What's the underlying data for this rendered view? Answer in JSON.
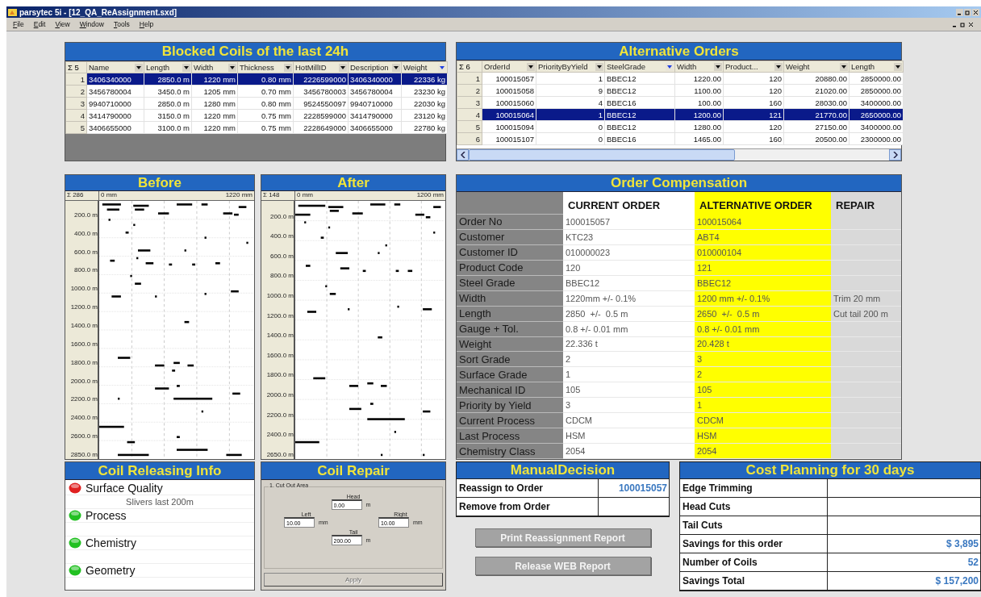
{
  "window": {
    "title": "parsytec 5i - [12_QA_ReAssignment.sxd]"
  },
  "menu": [
    "File",
    "Edit",
    "View",
    "Window",
    "Tools",
    "Help"
  ],
  "blocked_coils": {
    "title": "Blocked Coils of the last 24h",
    "count": "Σ 5",
    "columns": [
      {
        "label": "Name",
        "sorted": false
      },
      {
        "label": "Length",
        "sorted": false
      },
      {
        "label": "Width",
        "sorted": false
      },
      {
        "label": "Thickness",
        "sorted": false
      },
      {
        "label": "HotMillID",
        "sorted": false
      },
      {
        "label": "Description",
        "sorted": false
      },
      {
        "label": "Weight",
        "sorted": true
      }
    ],
    "rows": [
      {
        "index": "1",
        "selected": true,
        "cells": [
          "3406340000",
          "2850.0 m",
          "1220 mm",
          "0.80 mm",
          "2226599000",
          "3406340000",
          "22336 kg"
        ]
      },
      {
        "index": "2",
        "selected": false,
        "cells": [
          "3456780004",
          "3450.0 m",
          "1205 mm",
          "0.70 mm",
          "3456780003",
          "3456780004",
          "23230 kg"
        ]
      },
      {
        "index": "3",
        "selected": false,
        "cells": [
          "9940710000",
          "2850.0 m",
          "1280 mm",
          "0.80 mm",
          "9524550097",
          "9940710000",
          "22030 kg"
        ]
      },
      {
        "index": "4",
        "selected": false,
        "cells": [
          "3414790000",
          "3150.0 m",
          "1220 mm",
          "0.75 mm",
          "2228599000",
          "3414790000",
          "23120 kg"
        ]
      },
      {
        "index": "5",
        "selected": false,
        "cells": [
          "3406655000",
          "3100.0 m",
          "1220 mm",
          "0.75 mm",
          "2228649000",
          "3406655000",
          "22780 kg"
        ]
      }
    ]
  },
  "alternative_orders": {
    "title": "Alternative Orders",
    "count": "Σ 6",
    "columns": [
      {
        "label": "OrderId",
        "sorted": false
      },
      {
        "label": "PriorityByYield",
        "sorted": false
      },
      {
        "label": "SteelGrade",
        "sorted": true
      },
      {
        "label": "Width",
        "sorted": false
      },
      {
        "label": "Product...",
        "sorted": false
      },
      {
        "label": "Weight",
        "sorted": false
      },
      {
        "label": "Length",
        "sorted": false
      }
    ],
    "rows": [
      {
        "index": "1",
        "selected": false,
        "cells": [
          "100015057",
          "1",
          "BBEC12",
          "1220.00",
          "120",
          "20880.00",
          "2850000.00"
        ]
      },
      {
        "index": "2",
        "selected": false,
        "cells": [
          "100015058",
          "9",
          "BBEC12",
          "1100.00",
          "120",
          "21020.00",
          "2850000.00"
        ]
      },
      {
        "index": "3",
        "selected": false,
        "cells": [
          "100015060",
          "4",
          "BBEC16",
          "100.00",
          "160",
          "28030.00",
          "3400000.00"
        ]
      },
      {
        "index": "4",
        "selected": true,
        "cells": [
          "100015064",
          "1",
          "BBEC12",
          "1200.00",
          "121",
          "21770.00",
          "2650000.00"
        ]
      },
      {
        "index": "5",
        "selected": false,
        "cells": [
          "100015094",
          "0",
          "BBEC12",
          "1280.00",
          "120",
          "27150.00",
          "3400000.00"
        ]
      },
      {
        "index": "6",
        "selected": false,
        "cells": [
          "100015107",
          "0",
          "BBEC16",
          "1465.00",
          "160",
          "20500.00",
          "2300000.00"
        ]
      }
    ]
  },
  "before": {
    "title": "Before",
    "count": "Σ 286",
    "x_start": "0 mm",
    "x_end": "1220 mm",
    "y_ticks": [
      "200.0 m",
      "400.0 m",
      "600.0 m",
      "800.0 m",
      "1000.0 m",
      "1200.0 m",
      "1400.0 m",
      "1600.0 m",
      "1800.0 m",
      "2000.0 m",
      "2200.0 m",
      "2400.0 m",
      "2600.0 m",
      "2850.0 m"
    ]
  },
  "after": {
    "title": "After",
    "count": "Σ 148",
    "x_start": "0 mm",
    "x_end": "1200 mm",
    "y_ticks": [
      "200.0 m",
      "400.0 m",
      "600.0 m",
      "800.0 m",
      "1000.0 m",
      "1200.0 m",
      "1400.0 m",
      "1600.0 m",
      "1800.0 m",
      "2000.0 m",
      "2200.0 m",
      "2400.0 m",
      "2650.0 m"
    ]
  },
  "order_compensation": {
    "title": "Order Compensation",
    "columns": [
      "CURRENT ORDER",
      "ALTERNATIVE ORDER",
      "REPAIR"
    ],
    "rows": [
      {
        "label": "Order No",
        "current": "100015057",
        "alternative": "100015064"
      },
      {
        "label": "Customer",
        "current": "KTC23",
        "alternative": "ABT4"
      },
      {
        "label": "Customer ID",
        "current": "010000023",
        "alternative": "010000104"
      },
      {
        "label": "Product Code",
        "current": "120",
        "alternative": "121"
      },
      {
        "label": "Steel Grade",
        "current": "BBEC12",
        "alternative": "BBEC12"
      },
      {
        "label": "Width",
        "current": "1220mm +/- 0.1%",
        "alternative": "1200 mm +/- 0.1%",
        "repair": "Trim 20 mm"
      },
      {
        "label": "Length",
        "current": "2850  +/-  0.5 m",
        "alternative": "2650  +/-  0.5 m",
        "repair": "Cut tail 200 m"
      },
      {
        "label": "Gauge + Tol.",
        "current": "0.8 +/- 0.01 mm",
        "alternative": "0.8 +/- 0.01 mm"
      },
      {
        "label": "Weight",
        "current": "22.336 t",
        "alternative": "20.428 t"
      },
      {
        "label": "Sort Grade",
        "current": "2",
        "alternative": "3"
      },
      {
        "label": "Surface Grade",
        "current": "1",
        "alternative": "2"
      },
      {
        "label": "Mechanical ID",
        "current": "105",
        "alternative": "105"
      },
      {
        "label": "Priority by Yield",
        "current": "3",
        "alternative": "1"
      },
      {
        "label": "Current Process",
        "current": "CDCM",
        "alternative": "CDCM"
      },
      {
        "label": "Last Process",
        "current": "HSM",
        "alternative": "HSM"
      },
      {
        "label": "Chemistry Class",
        "current": "2054",
        "alternative": "2054"
      }
    ]
  },
  "coil_releasing": {
    "title": "Coil Releasing Info",
    "items": [
      {
        "label": "Surface Quality",
        "color": "#e02020",
        "note": "Slivers last 200m"
      },
      {
        "label": "Process",
        "color": "#22c022"
      },
      {
        "label": "Chemistry",
        "color": "#22c022"
      },
      {
        "label": "Geometry",
        "color": "#22c022"
      }
    ]
  },
  "coil_repair": {
    "title": "Coil Repair",
    "group": "1. Cut Out Area",
    "head": {
      "label": "Head",
      "value": "0.00",
      "unit": "m"
    },
    "left": {
      "label": "Left",
      "value": "10.00",
      "unit": "mm"
    },
    "right": {
      "label": "Right",
      "value": "10.00",
      "unit": "mm"
    },
    "tail": {
      "label": "Tail",
      "value": "200.00",
      "unit": "m"
    },
    "apply": {
      "label": "Apply",
      "disabled": true
    }
  },
  "manual_decision": {
    "title": "ManualDecision",
    "rows": [
      {
        "label": "Reassign to Order",
        "value": "100015057"
      },
      {
        "label": "Remove from Order"
      }
    ],
    "buttons": [
      {
        "label": "Print Reassignment Report",
        "disabled": true
      },
      {
        "label": "Release WEB Report",
        "disabled": true
      }
    ]
  },
  "cost_planning": {
    "title": "Cost Planning for 30 days",
    "rows": [
      {
        "label": "Edge Trimming"
      },
      {
        "label": "Head Cuts"
      },
      {
        "label": "Tail Cuts"
      },
      {
        "label": "Savings for this order",
        "value": "$ 3,895"
      },
      {
        "label": "Number of Coils",
        "value": "52"
      },
      {
        "label": "Savings Total",
        "value": "$ 157,200"
      }
    ]
  }
}
